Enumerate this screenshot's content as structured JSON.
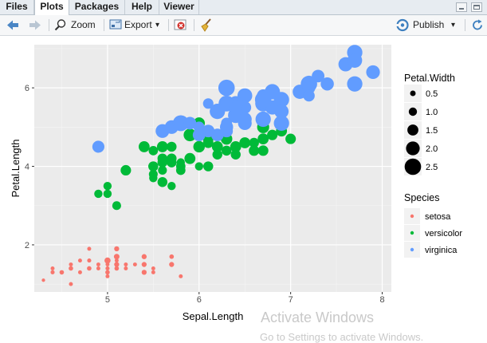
{
  "tabs": [
    "Files",
    "Plots",
    "Packages",
    "Help",
    "Viewer"
  ],
  "toolbar": {
    "zoom_label": "Zoom",
    "export_label": "Export",
    "export_arrow": "▾",
    "publish_label": "Publish",
    "publish_arrow": "▾"
  },
  "watermark": {
    "line1": "Activate Windows",
    "line2": "Go to Settings to activate Windows."
  },
  "chart_data": {
    "type": "scatter",
    "title": "",
    "xlabel": "Sepal.Length",
    "ylabel": "Petal.Length",
    "xlim": [
      4.2,
      8.1
    ],
    "ylim": [
      0.8,
      7.1
    ],
    "x_ticks": [
      5,
      6,
      7,
      8
    ],
    "y_ticks": [
      2,
      4,
      6
    ],
    "grid": true,
    "legend_position": "right",
    "size_legend": {
      "title": "Petal.Width",
      "values": [
        "0.5",
        "1.0",
        "1.5",
        "2.0",
        "2.5"
      ]
    },
    "color_legend": {
      "title": "Species",
      "entries": [
        {
          "name": "setosa",
          "color": "#F8766D"
        },
        {
          "name": "versicolor",
          "color": "#00BA38"
        },
        {
          "name": "virginica",
          "color": "#619CFF"
        }
      ]
    },
    "series": [
      {
        "name": "setosa",
        "color": "#F8766D",
        "points": [
          [
            5.1,
            1.4,
            0.2
          ],
          [
            4.9,
            1.4,
            0.2
          ],
          [
            4.7,
            1.3,
            0.2
          ],
          [
            4.6,
            1.5,
            0.2
          ],
          [
            5.0,
            1.4,
            0.2
          ],
          [
            5.4,
            1.7,
            0.4
          ],
          [
            4.6,
            1.4,
            0.3
          ],
          [
            5.0,
            1.5,
            0.2
          ],
          [
            4.4,
            1.4,
            0.2
          ],
          [
            4.9,
            1.5,
            0.1
          ],
          [
            5.4,
            1.5,
            0.2
          ],
          [
            4.8,
            1.6,
            0.2
          ],
          [
            4.8,
            1.4,
            0.1
          ],
          [
            4.3,
            1.1,
            0.1
          ],
          [
            5.8,
            1.2,
            0.2
          ],
          [
            5.7,
            1.5,
            0.4
          ],
          [
            5.4,
            1.3,
            0.4
          ],
          [
            5.1,
            1.4,
            0.3
          ],
          [
            5.7,
            1.7,
            0.3
          ],
          [
            5.1,
            1.5,
            0.3
          ],
          [
            5.4,
            1.7,
            0.2
          ],
          [
            5.1,
            1.5,
            0.4
          ],
          [
            4.6,
            1.0,
            0.2
          ],
          [
            5.1,
            1.7,
            0.5
          ],
          [
            4.8,
            1.9,
            0.2
          ],
          [
            5.0,
            1.6,
            0.2
          ],
          [
            5.0,
            1.6,
            0.4
          ],
          [
            5.2,
            1.5,
            0.2
          ],
          [
            5.2,
            1.4,
            0.2
          ],
          [
            4.7,
            1.6,
            0.2
          ],
          [
            4.8,
            1.6,
            0.2
          ],
          [
            5.4,
            1.5,
            0.4
          ],
          [
            5.2,
            1.5,
            0.1
          ],
          [
            5.5,
            1.4,
            0.2
          ],
          [
            4.9,
            1.5,
            0.2
          ],
          [
            5.0,
            1.2,
            0.2
          ],
          [
            5.5,
            1.3,
            0.2
          ],
          [
            4.9,
            1.4,
            0.1
          ],
          [
            4.4,
            1.3,
            0.2
          ],
          [
            5.1,
            1.5,
            0.2
          ],
          [
            5.0,
            1.3,
            0.3
          ],
          [
            4.5,
            1.3,
            0.3
          ],
          [
            4.4,
            1.3,
            0.2
          ],
          [
            5.0,
            1.6,
            0.6
          ],
          [
            5.1,
            1.9,
            0.4
          ],
          [
            4.8,
            1.4,
            0.3
          ],
          [
            5.1,
            1.6,
            0.2
          ],
          [
            4.6,
            1.4,
            0.2
          ],
          [
            5.3,
            1.5,
            0.2
          ],
          [
            5.0,
            1.4,
            0.2
          ]
        ]
      },
      {
        "name": "versicolor",
        "color": "#00BA38",
        "points": [
          [
            7.0,
            4.7,
            1.4
          ],
          [
            6.4,
            4.5,
            1.5
          ],
          [
            6.9,
            4.9,
            1.5
          ],
          [
            5.5,
            4.0,
            1.3
          ],
          [
            6.5,
            4.6,
            1.5
          ],
          [
            5.7,
            4.5,
            1.3
          ],
          [
            6.3,
            4.7,
            1.6
          ],
          [
            4.9,
            3.3,
            1.0
          ],
          [
            6.6,
            4.6,
            1.3
          ],
          [
            5.2,
            3.9,
            1.4
          ],
          [
            5.0,
            3.5,
            1.0
          ],
          [
            5.9,
            4.2,
            1.5
          ],
          [
            6.0,
            4.0,
            1.0
          ],
          [
            6.1,
            4.7,
            1.4
          ],
          [
            5.6,
            3.6,
            1.3
          ],
          [
            6.7,
            4.4,
            1.4
          ],
          [
            5.6,
            4.5,
            1.5
          ],
          [
            5.8,
            4.1,
            1.0
          ],
          [
            6.2,
            4.5,
            1.5
          ],
          [
            5.6,
            3.9,
            1.1
          ],
          [
            5.9,
            4.8,
            1.8
          ],
          [
            6.1,
            4.0,
            1.3
          ],
          [
            6.3,
            4.9,
            1.5
          ],
          [
            6.1,
            4.7,
            1.2
          ],
          [
            6.4,
            4.3,
            1.3
          ],
          [
            6.6,
            4.4,
            1.4
          ],
          [
            6.8,
            4.8,
            1.4
          ],
          [
            6.7,
            5.0,
            1.7
          ],
          [
            6.0,
            4.5,
            1.5
          ],
          [
            5.7,
            3.5,
            1.0
          ],
          [
            5.5,
            3.8,
            1.1
          ],
          [
            5.5,
            3.7,
            1.0
          ],
          [
            5.8,
            3.9,
            1.2
          ],
          [
            6.0,
            5.1,
            1.6
          ],
          [
            5.4,
            4.5,
            1.5
          ],
          [
            6.0,
            4.5,
            1.6
          ],
          [
            6.7,
            4.7,
            1.5
          ],
          [
            6.3,
            4.4,
            1.3
          ],
          [
            5.6,
            4.1,
            1.3
          ],
          [
            5.5,
            4.0,
            1.3
          ],
          [
            5.5,
            4.4,
            1.2
          ],
          [
            6.1,
            4.6,
            1.4
          ],
          [
            5.8,
            4.0,
            1.2
          ],
          [
            5.0,
            3.3,
            1.0
          ],
          [
            5.6,
            4.2,
            1.3
          ],
          [
            5.7,
            4.2,
            1.2
          ],
          [
            5.7,
            4.2,
            1.3
          ],
          [
            6.2,
            4.3,
            1.3
          ],
          [
            5.1,
            3.0,
            1.1
          ],
          [
            5.7,
            4.1,
            1.3
          ]
        ]
      },
      {
        "name": "virginica",
        "color": "#619CFF",
        "points": [
          [
            6.3,
            6.0,
            2.5
          ],
          [
            5.8,
            5.1,
            1.9
          ],
          [
            7.1,
            5.9,
            2.1
          ],
          [
            6.3,
            5.6,
            1.8
          ],
          [
            6.5,
            5.8,
            2.2
          ],
          [
            7.6,
            6.6,
            2.1
          ],
          [
            4.9,
            4.5,
            1.7
          ],
          [
            7.3,
            6.3,
            1.8
          ],
          [
            6.7,
            5.8,
            1.8
          ],
          [
            7.2,
            6.1,
            2.5
          ],
          [
            6.5,
            5.1,
            2.0
          ],
          [
            6.4,
            5.3,
            1.9
          ],
          [
            6.8,
            5.5,
            2.1
          ],
          [
            5.7,
            5.0,
            2.0
          ],
          [
            5.8,
            5.1,
            2.4
          ],
          [
            6.4,
            5.3,
            2.3
          ],
          [
            6.5,
            5.5,
            1.8
          ],
          [
            7.7,
            6.7,
            2.2
          ],
          [
            7.7,
            6.9,
            2.3
          ],
          [
            6.0,
            5.0,
            1.5
          ],
          [
            6.9,
            5.7,
            2.3
          ],
          [
            5.6,
            4.9,
            2.0
          ],
          [
            7.7,
            6.7,
            2.0
          ],
          [
            6.3,
            4.9,
            1.8
          ],
          [
            6.7,
            5.7,
            2.1
          ],
          [
            7.2,
            6.0,
            1.8
          ],
          [
            6.2,
            4.8,
            1.8
          ],
          [
            6.1,
            4.9,
            1.8
          ],
          [
            6.4,
            5.6,
            2.1
          ],
          [
            7.2,
            5.8,
            1.6
          ],
          [
            7.4,
            6.1,
            1.9
          ],
          [
            7.9,
            6.4,
            2.0
          ],
          [
            6.4,
            5.6,
            2.2
          ],
          [
            6.3,
            5.1,
            1.5
          ],
          [
            6.1,
            5.6,
            1.4
          ],
          [
            7.7,
            6.1,
            2.3
          ],
          [
            6.3,
            5.6,
            2.4
          ],
          [
            6.4,
            5.5,
            1.8
          ],
          [
            6.0,
            4.8,
            1.8
          ],
          [
            6.9,
            5.4,
            2.1
          ],
          [
            6.7,
            5.6,
            2.4
          ],
          [
            6.9,
            5.1,
            2.3
          ],
          [
            5.8,
            5.1,
            1.9
          ],
          [
            6.8,
            5.9,
            2.3
          ],
          [
            6.7,
            5.7,
            2.5
          ],
          [
            6.7,
            5.2,
            2.3
          ],
          [
            6.3,
            5.0,
            1.9
          ],
          [
            6.5,
            5.2,
            2.0
          ],
          [
            6.2,
            5.4,
            2.3
          ],
          [
            5.9,
            5.1,
            1.8
          ]
        ]
      }
    ]
  }
}
